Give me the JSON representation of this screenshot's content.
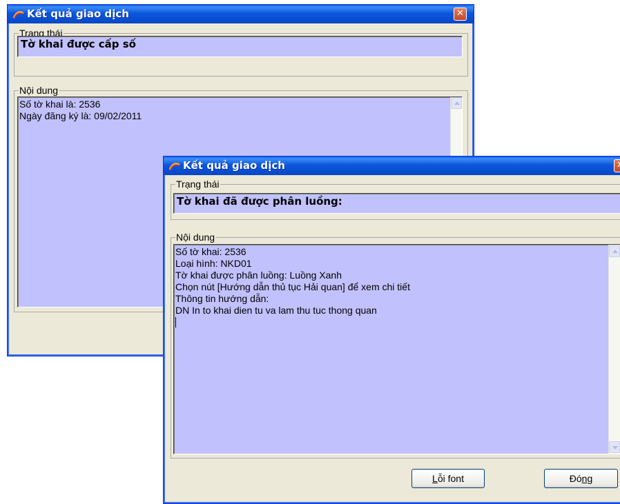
{
  "window_back": {
    "title": "Kết quả giao dịch",
    "status_group_label": "Trạng thái",
    "status_text": "Tờ khai được cấp số",
    "content_group_label": "Nội dung",
    "content_lines": [
      "Số tờ khai là: 2536",
      "Ngày đăng ký là: 09/02/2011"
    ]
  },
  "window_front": {
    "title": "Kết quả giao dịch",
    "status_group_label": "Trạng thái",
    "status_text": "Tờ khai đã được phân luồng:",
    "content_group_label": "Nội dung",
    "content_lines": [
      "Số tờ khai: 2536",
      "Loại hình: NKD01",
      "Tờ khai được phân luồng: Luồng Xanh",
      "Chọn nút [Hướng dẫn thủ tục Hải quan] để xem chi tiết",
      "Thông tin hướng dẫn:",
      "DN In to khai dien tu va lam thu tuc thong quan"
    ],
    "buttons": {
      "font_error": {
        "prefix": "",
        "mnemonic": "L",
        "rest": "ỗi font"
      },
      "close": {
        "prefix": "Đó",
        "mnemonic": "n",
        "rest": "g"
      }
    }
  },
  "icons": {
    "app_icon": "arc-logo-icon",
    "close_icon": "close-x-icon",
    "scroll_up": "chevron-up-icon",
    "scroll_down": "chevron-down-icon"
  },
  "colors": {
    "title_bar": "#0b57dd",
    "field_background": "#c1c1fd",
    "window_face": "#ece9d8",
    "close_button": "#d2553a"
  }
}
